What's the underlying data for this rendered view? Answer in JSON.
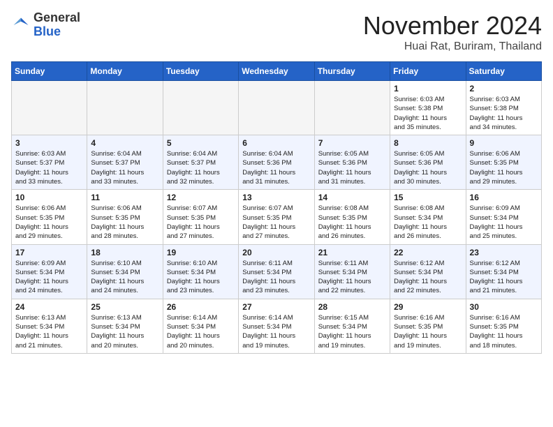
{
  "logo": {
    "general": "General",
    "blue": "Blue"
  },
  "title": "November 2024",
  "location": "Huai Rat, Buriram, Thailand",
  "weekdays": [
    "Sunday",
    "Monday",
    "Tuesday",
    "Wednesday",
    "Thursday",
    "Friday",
    "Saturday"
  ],
  "weeks": [
    [
      {
        "day": "",
        "info": ""
      },
      {
        "day": "",
        "info": ""
      },
      {
        "day": "",
        "info": ""
      },
      {
        "day": "",
        "info": ""
      },
      {
        "day": "",
        "info": ""
      },
      {
        "day": "1",
        "info": "Sunrise: 6:03 AM\nSunset: 5:38 PM\nDaylight: 11 hours\nand 35 minutes."
      },
      {
        "day": "2",
        "info": "Sunrise: 6:03 AM\nSunset: 5:38 PM\nDaylight: 11 hours\nand 34 minutes."
      }
    ],
    [
      {
        "day": "3",
        "info": "Sunrise: 6:03 AM\nSunset: 5:37 PM\nDaylight: 11 hours\nand 33 minutes."
      },
      {
        "day": "4",
        "info": "Sunrise: 6:04 AM\nSunset: 5:37 PM\nDaylight: 11 hours\nand 33 minutes."
      },
      {
        "day": "5",
        "info": "Sunrise: 6:04 AM\nSunset: 5:37 PM\nDaylight: 11 hours\nand 32 minutes."
      },
      {
        "day": "6",
        "info": "Sunrise: 6:04 AM\nSunset: 5:36 PM\nDaylight: 11 hours\nand 31 minutes."
      },
      {
        "day": "7",
        "info": "Sunrise: 6:05 AM\nSunset: 5:36 PM\nDaylight: 11 hours\nand 31 minutes."
      },
      {
        "day": "8",
        "info": "Sunrise: 6:05 AM\nSunset: 5:36 PM\nDaylight: 11 hours\nand 30 minutes."
      },
      {
        "day": "9",
        "info": "Sunrise: 6:06 AM\nSunset: 5:35 PM\nDaylight: 11 hours\nand 29 minutes."
      }
    ],
    [
      {
        "day": "10",
        "info": "Sunrise: 6:06 AM\nSunset: 5:35 PM\nDaylight: 11 hours\nand 29 minutes."
      },
      {
        "day": "11",
        "info": "Sunrise: 6:06 AM\nSunset: 5:35 PM\nDaylight: 11 hours\nand 28 minutes."
      },
      {
        "day": "12",
        "info": "Sunrise: 6:07 AM\nSunset: 5:35 PM\nDaylight: 11 hours\nand 27 minutes."
      },
      {
        "day": "13",
        "info": "Sunrise: 6:07 AM\nSunset: 5:35 PM\nDaylight: 11 hours\nand 27 minutes."
      },
      {
        "day": "14",
        "info": "Sunrise: 6:08 AM\nSunset: 5:35 PM\nDaylight: 11 hours\nand 26 minutes."
      },
      {
        "day": "15",
        "info": "Sunrise: 6:08 AM\nSunset: 5:34 PM\nDaylight: 11 hours\nand 26 minutes."
      },
      {
        "day": "16",
        "info": "Sunrise: 6:09 AM\nSunset: 5:34 PM\nDaylight: 11 hours\nand 25 minutes."
      }
    ],
    [
      {
        "day": "17",
        "info": "Sunrise: 6:09 AM\nSunset: 5:34 PM\nDaylight: 11 hours\nand 24 minutes."
      },
      {
        "day": "18",
        "info": "Sunrise: 6:10 AM\nSunset: 5:34 PM\nDaylight: 11 hours\nand 24 minutes."
      },
      {
        "day": "19",
        "info": "Sunrise: 6:10 AM\nSunset: 5:34 PM\nDaylight: 11 hours\nand 23 minutes."
      },
      {
        "day": "20",
        "info": "Sunrise: 6:11 AM\nSunset: 5:34 PM\nDaylight: 11 hours\nand 23 minutes."
      },
      {
        "day": "21",
        "info": "Sunrise: 6:11 AM\nSunset: 5:34 PM\nDaylight: 11 hours\nand 22 minutes."
      },
      {
        "day": "22",
        "info": "Sunrise: 6:12 AM\nSunset: 5:34 PM\nDaylight: 11 hours\nand 22 minutes."
      },
      {
        "day": "23",
        "info": "Sunrise: 6:12 AM\nSunset: 5:34 PM\nDaylight: 11 hours\nand 21 minutes."
      }
    ],
    [
      {
        "day": "24",
        "info": "Sunrise: 6:13 AM\nSunset: 5:34 PM\nDaylight: 11 hours\nand 21 minutes."
      },
      {
        "day": "25",
        "info": "Sunrise: 6:13 AM\nSunset: 5:34 PM\nDaylight: 11 hours\nand 20 minutes."
      },
      {
        "day": "26",
        "info": "Sunrise: 6:14 AM\nSunset: 5:34 PM\nDaylight: 11 hours\nand 20 minutes."
      },
      {
        "day": "27",
        "info": "Sunrise: 6:14 AM\nSunset: 5:34 PM\nDaylight: 11 hours\nand 19 minutes."
      },
      {
        "day": "28",
        "info": "Sunrise: 6:15 AM\nSunset: 5:34 PM\nDaylight: 11 hours\nand 19 minutes."
      },
      {
        "day": "29",
        "info": "Sunrise: 6:16 AM\nSunset: 5:35 PM\nDaylight: 11 hours\nand 19 minutes."
      },
      {
        "day": "30",
        "info": "Sunrise: 6:16 AM\nSunset: 5:35 PM\nDaylight: 11 hours\nand 18 minutes."
      }
    ]
  ]
}
